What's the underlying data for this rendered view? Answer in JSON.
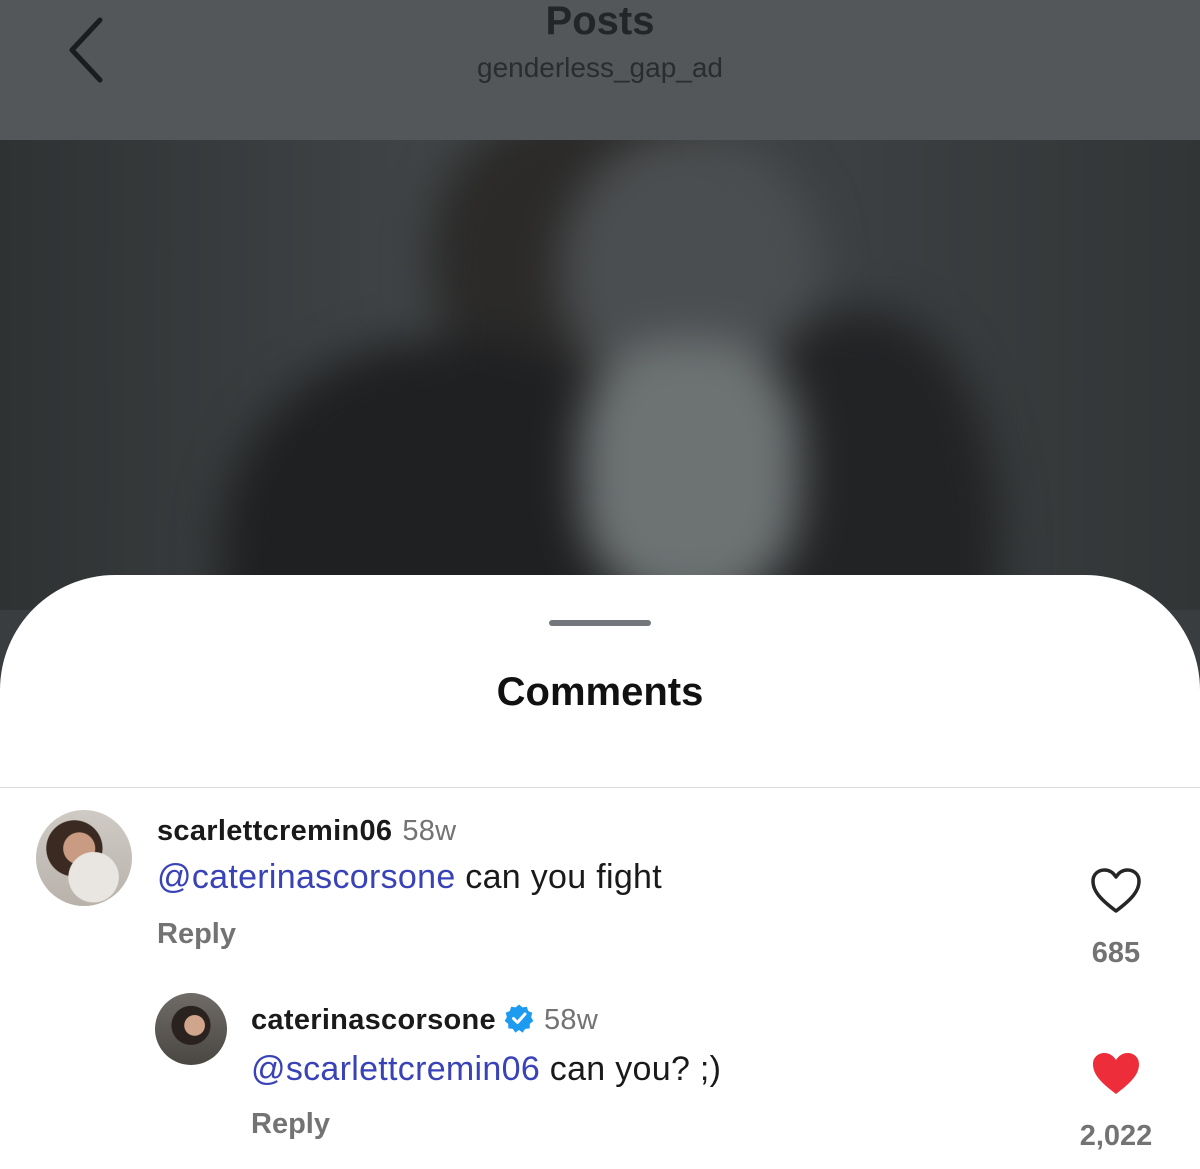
{
  "header": {
    "title": "Posts",
    "subtitle": "genderless_gap_ad"
  },
  "sheet": {
    "title": "Comments"
  },
  "comments": [
    {
      "username": "scarlettcremin06",
      "time": "58w",
      "mention": "@caterinascorsone",
      "text": " can you fight",
      "reply_label": "Reply",
      "likes": "685",
      "liked": false
    },
    {
      "username": "caterinascorsone",
      "verified": true,
      "time": "58w",
      "mention": "@scarlettcremin06",
      "text": " can you? ;)",
      "reply_label": "Reply",
      "likes": "2,022",
      "liked": true
    }
  ],
  "colors": {
    "mention": "#3943b7",
    "liked_heart": "#ed2d3a",
    "verified_badge": "#1d9bf0"
  }
}
